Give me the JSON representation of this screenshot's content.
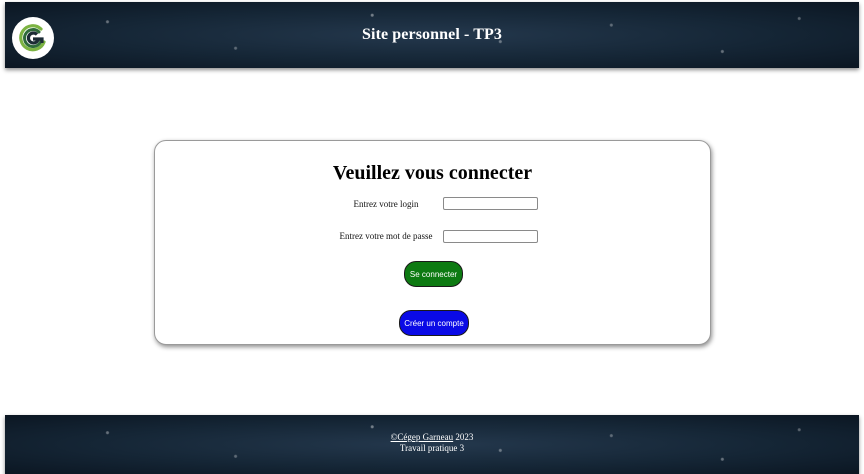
{
  "header": {
    "logo_icon": "cegep-garneau-g-logo-icon",
    "title": "Site personnel - TP3"
  },
  "login": {
    "heading": "Veuillez vous connecter",
    "login_label": "Entrez votre login",
    "login_value": "",
    "password_label": "Entrez votre mot de passe",
    "password_value": "",
    "connect_button": "Se connecter",
    "create_account_button": "Créer un compte"
  },
  "footer": {
    "copyright_link": "©Cégep Garneau",
    "year": "2023",
    "subtitle": "Travail pratique 3"
  },
  "colors": {
    "connect_button": "#0d7a12",
    "create_button": "#0a0ae6",
    "banner_dark": "#152636",
    "logo_green": "#7cb342"
  }
}
